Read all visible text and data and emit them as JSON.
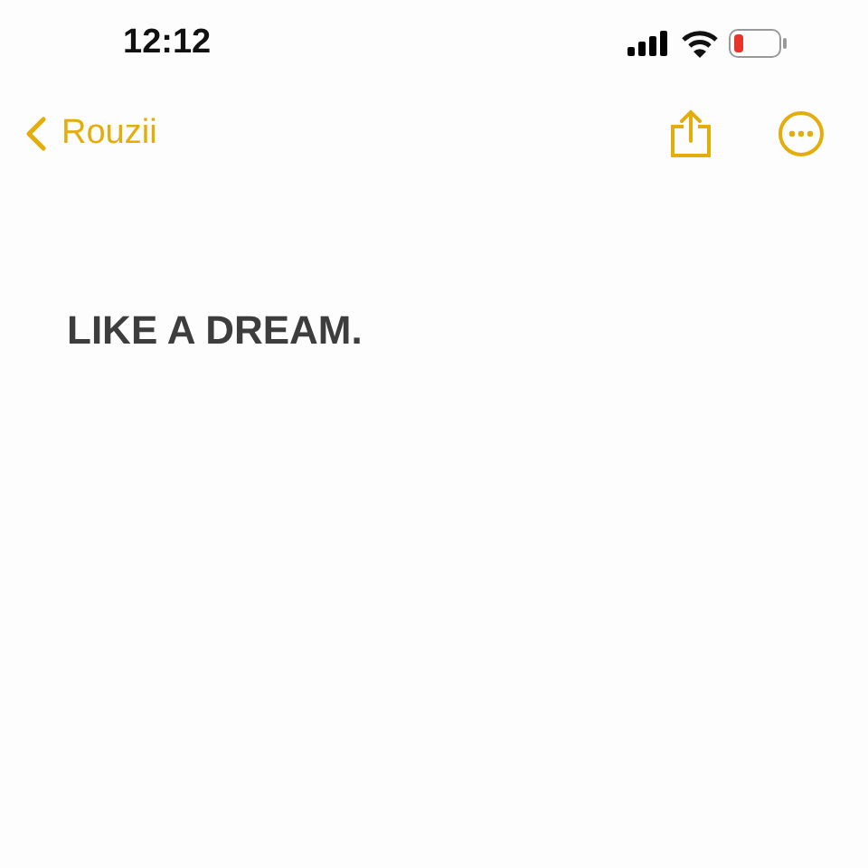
{
  "status_bar": {
    "time": "12:12"
  },
  "nav_bar": {
    "back_label": "Rouzii"
  },
  "note": {
    "text": "LIKE A DREAM."
  }
}
